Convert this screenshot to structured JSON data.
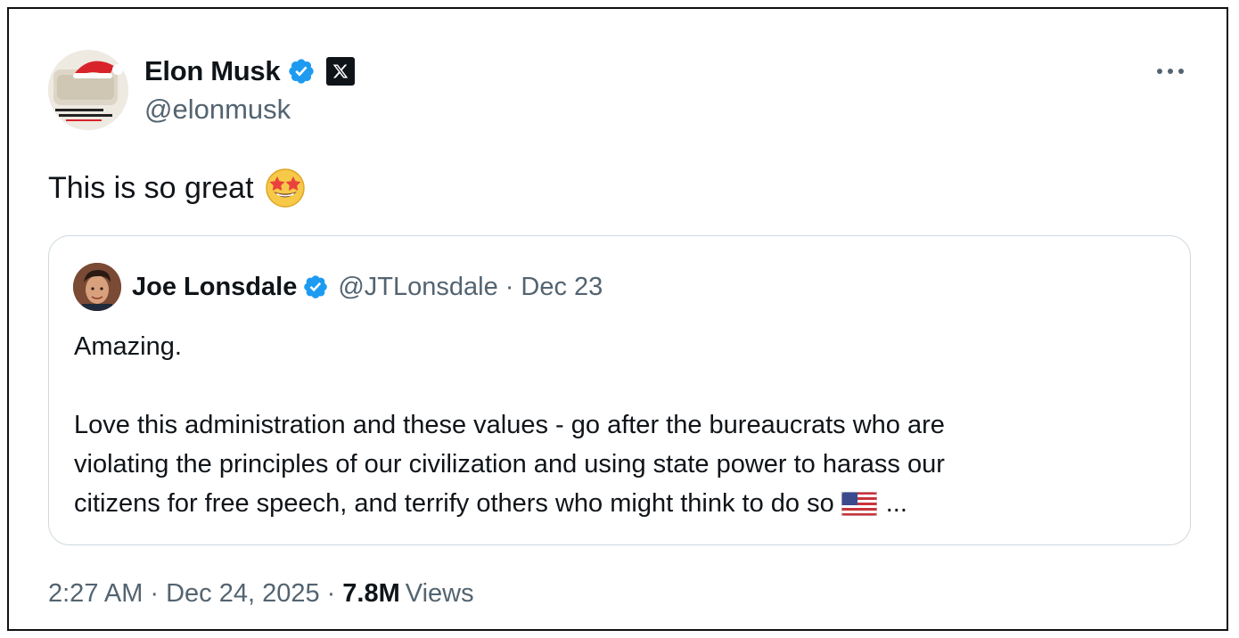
{
  "tweet": {
    "author": {
      "name": "Elon Musk",
      "handle": "@elonmusk"
    },
    "text": "This is so great",
    "emoji": "star-struck-emoji",
    "more_menu": "more-options-icon"
  },
  "quote": {
    "author": {
      "name": "Joe Lonsdale",
      "handle": "@JTLonsdale",
      "separator": "·",
      "date": "Dec 23"
    },
    "lines": {
      "first": "Amazing.",
      "second": "Love this administration and these values - go after the bureaucrats who are",
      "third": "violating the principles of our civilization and using state power to harass our",
      "fourth": "citizens for free speech, and terrify others who might think to do so",
      "ellipsis": "..."
    }
  },
  "meta": {
    "time": "2:27 AM",
    "separator": "·",
    "date": "Dec 24, 2025",
    "views_count": "7.8M",
    "views_label": "Views"
  },
  "colors": {
    "verified_blue": "#1d9bf0",
    "text_primary": "#0f1419",
    "text_secondary": "#536471",
    "border": "#cfd9de"
  }
}
